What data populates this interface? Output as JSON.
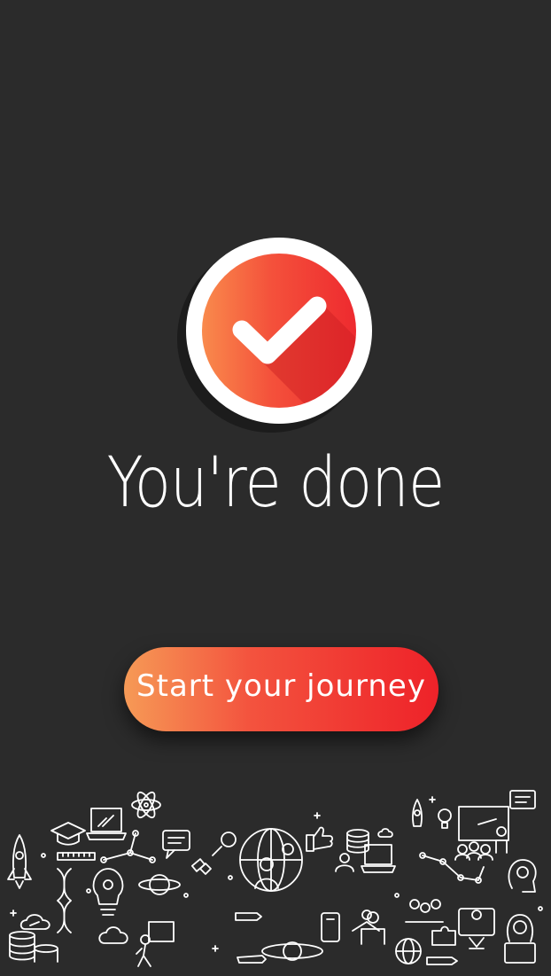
{
  "screen": {
    "title": "You're done",
    "cta_label": "Start your journey"
  },
  "badge": {
    "icon": "checkmark-icon",
    "gradient": [
      "#f98a4c",
      "#f4513b",
      "#ee2a2f"
    ]
  },
  "colors": {
    "background": "#2b2b2b",
    "accent_start": "#f69a56",
    "accent_end": "#ee2229",
    "text": "#ffffff"
  },
  "illustration": {
    "icons": [
      "rocket-icon",
      "graduation-cap-icon",
      "laptop-icon",
      "atom-icon",
      "chat-icon",
      "dna-icon",
      "lightbulb-icon",
      "planet-icon",
      "satellite-icon",
      "globe-icon",
      "thumbs-up-icon",
      "database-icon",
      "presentation-icon",
      "team-icon",
      "brain-icon",
      "cloud-icon",
      "constellation-icon",
      "puzzle-icon",
      "pencil-icon",
      "person-icon"
    ]
  }
}
